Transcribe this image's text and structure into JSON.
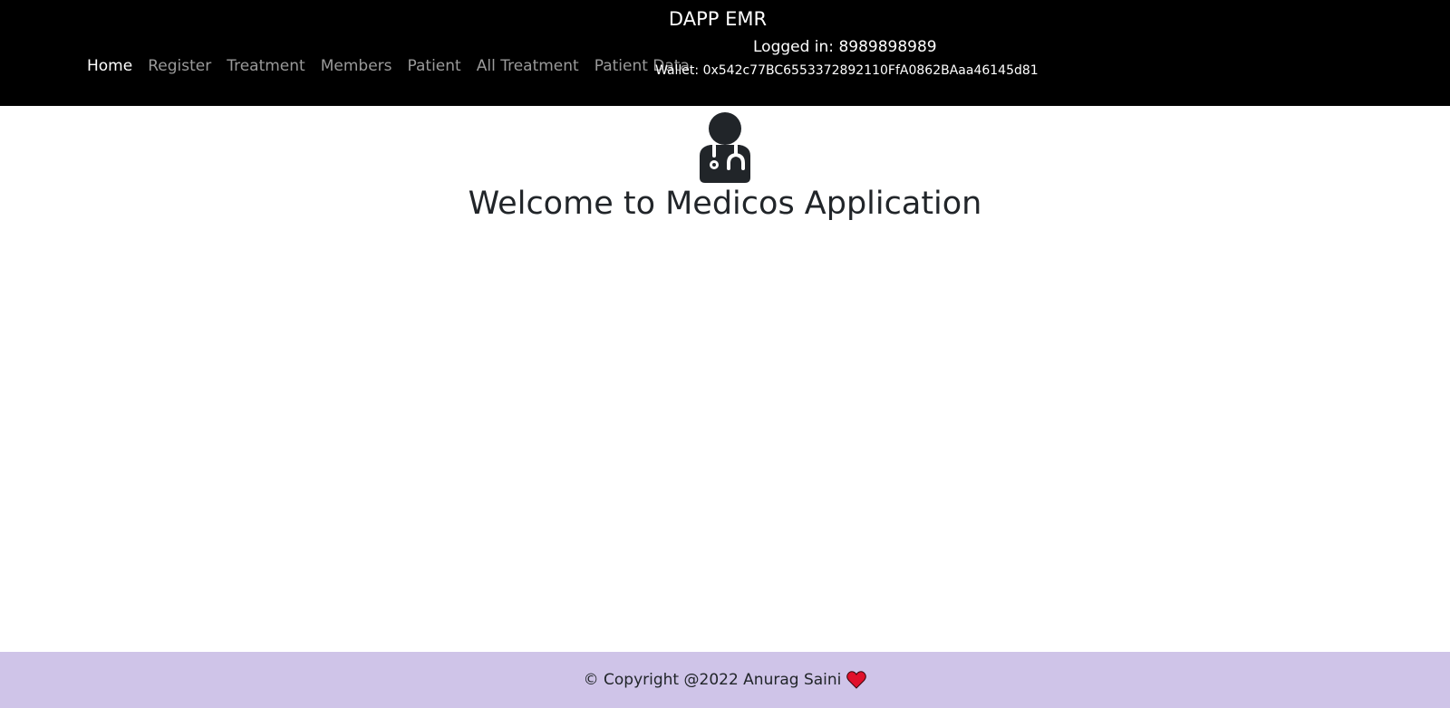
{
  "navbar": {
    "brand": "DAPP EMR",
    "links": [
      {
        "label": "Home",
        "active": true
      },
      {
        "label": "Register",
        "active": false
      },
      {
        "label": "Treatment",
        "active": false
      },
      {
        "label": "Members",
        "active": false
      },
      {
        "label": "Patient",
        "active": false
      },
      {
        "label": "All Treatment",
        "active": false
      },
      {
        "label": "Patient Data",
        "active": false
      }
    ],
    "logged_in": "Logged in: 8989898989",
    "wallet": "Wallet: 0x542c77BC6553372892110FfA0862BAaa46145d81"
  },
  "hero": {
    "icon": "doctor-icon",
    "title": "Welcome to Medicos Application"
  },
  "footer": {
    "text": "© Copyright @2022 Anurag Saini",
    "icon": "heart-icon"
  },
  "colors": {
    "navbar_bg": "#000000",
    "footer_bg": "#cfc4e8",
    "heart": "#e0112b",
    "title": "#212529"
  }
}
